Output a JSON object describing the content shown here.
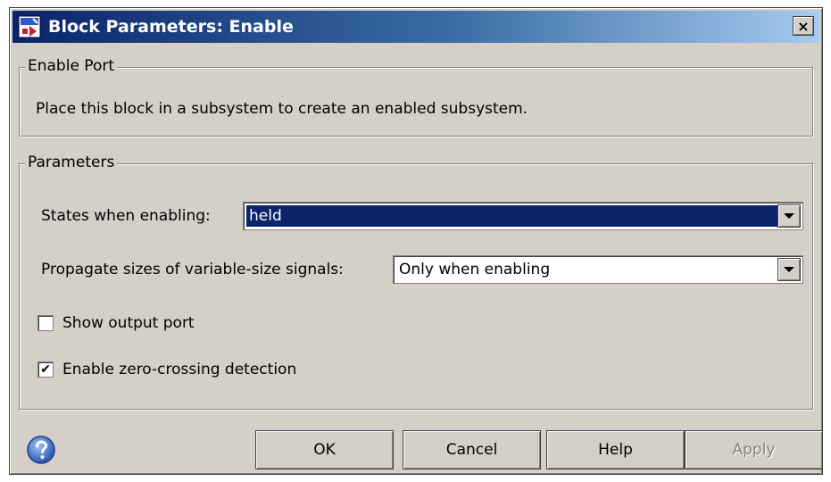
{
  "window": {
    "title": "Block Parameters: Enable",
    "close_label": "×"
  },
  "enable_port": {
    "legend": "Enable Port",
    "description": "Place this block in a subsystem to create an enabled subsystem."
  },
  "parameters": {
    "legend": "Parameters",
    "states_label": "States when enabling:",
    "states_value": "held",
    "propagate_label": "Propagate sizes of variable-size signals:",
    "propagate_value": "Only when enabling",
    "show_output_label": "Show output port",
    "show_output_checked": false,
    "zero_crossing_label": "Enable zero-crossing detection",
    "zero_crossing_checked": true,
    "check_mark": "✔"
  },
  "buttons": {
    "ok": "OK",
    "cancel": "Cancel",
    "help": "Help",
    "apply": "Apply"
  },
  "colors": {
    "title_gradient_start": "#0a246a",
    "dialog_face": "#d4d0c8",
    "selection": "#0a246a"
  }
}
